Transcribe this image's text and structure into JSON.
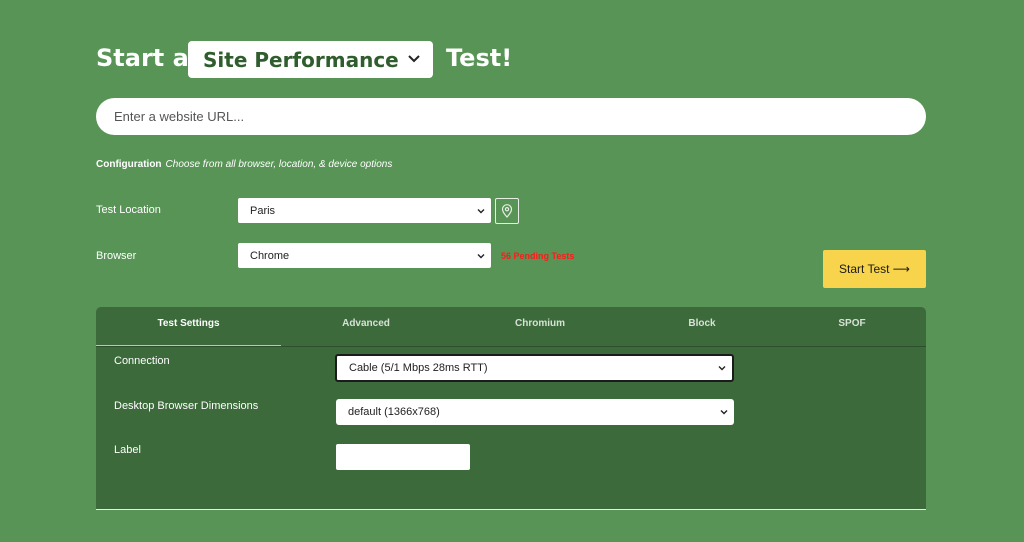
{
  "header": {
    "prefix": "Start a",
    "test_type": "Site Performance",
    "suffix": "Test!"
  },
  "url_input": {
    "placeholder": "Enter a website URL...",
    "value": ""
  },
  "configuration": {
    "title": "Configuration",
    "hint": "Choose from all browser, location, & device options"
  },
  "test_location": {
    "label": "Test Location",
    "value": "Paris",
    "map_icon": "map-pin-icon"
  },
  "browser": {
    "label": "Browser",
    "value": "Chrome",
    "pending": "56 Pending Tests"
  },
  "start_button": {
    "label": "Start Test ⟶"
  },
  "tabs": [
    {
      "label": "Test Settings",
      "active": true
    },
    {
      "label": "Advanced",
      "active": false
    },
    {
      "label": "Chromium",
      "active": false
    },
    {
      "label": "Block",
      "active": false
    },
    {
      "label": "SPOF",
      "active": false
    }
  ],
  "settings": {
    "connection": {
      "label": "Connection",
      "value": "Cable (5/1 Mbps 28ms RTT)"
    },
    "dimensions": {
      "label": "Desktop Browser Dimensions",
      "value": "default (1366x768)"
    },
    "label_field": {
      "label": "Label",
      "value": ""
    }
  },
  "colors": {
    "background": "#579455",
    "panel": "#3c6a3b",
    "start_button": "#f7d44c",
    "pending_text": "#ff1a1a",
    "select_text": "#2f5d2d"
  }
}
